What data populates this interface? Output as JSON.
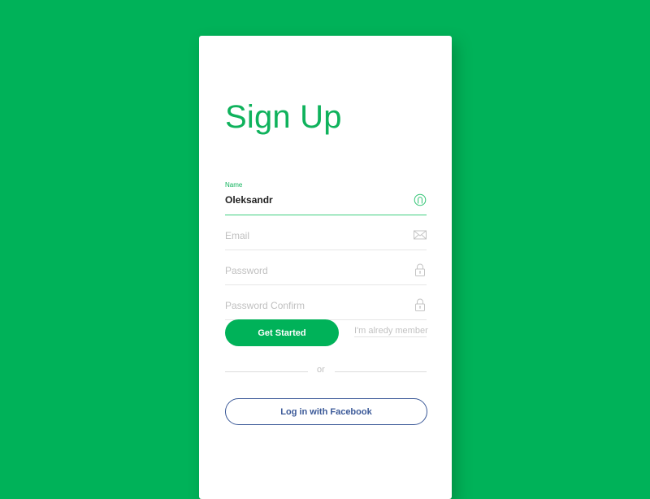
{
  "colors": {
    "background": "#00b259",
    "accent": "#0fb25c",
    "facebook": "#3b5998"
  },
  "form": {
    "title": "Sign Up",
    "fields": [
      {
        "label": "Name",
        "value": "Oleksandr",
        "placeholder": "Name",
        "icon": "user-icon",
        "active": true
      },
      {
        "label": "",
        "value": "",
        "placeholder": "Email",
        "icon": "mail-icon",
        "active": false
      },
      {
        "label": "",
        "value": "",
        "placeholder": "Password",
        "icon": "lock-icon",
        "active": false
      },
      {
        "label": "",
        "value": "",
        "placeholder": "Password Confirm",
        "icon": "lock-icon",
        "active": false
      }
    ],
    "primary_button": "Get Started",
    "member_link": "I'm alredy member",
    "separator": "or",
    "facebook_button": "Log in with Facebook"
  }
}
